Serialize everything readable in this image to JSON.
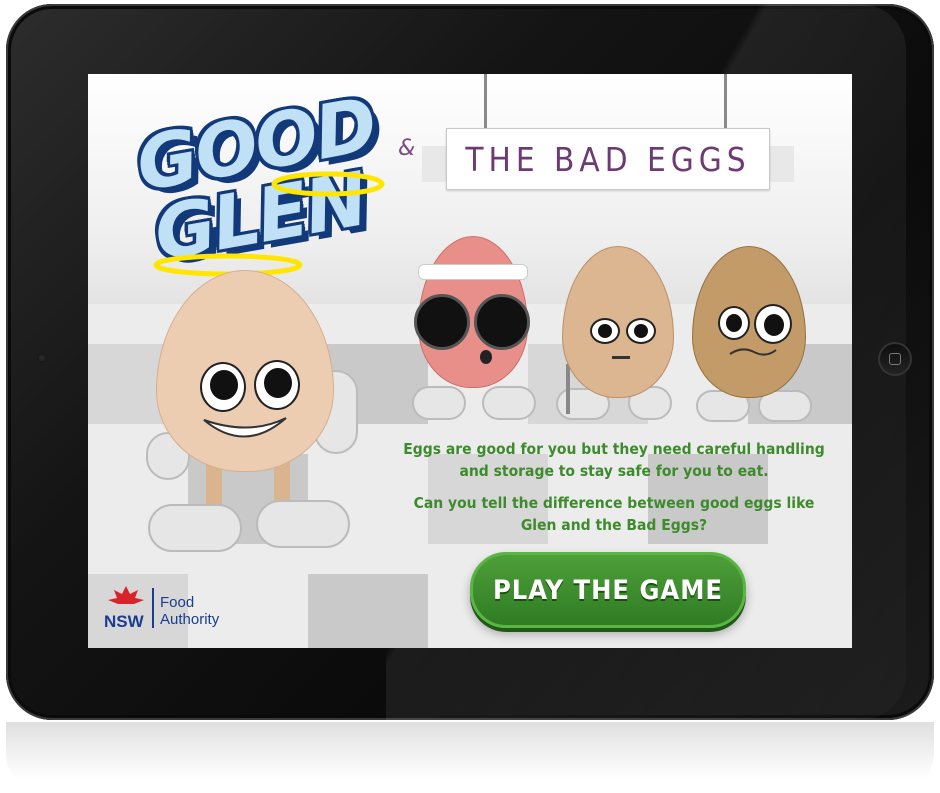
{
  "game": {
    "logo_line1": "GOOD",
    "logo_line2": "GLEN",
    "ampersand": "&",
    "subtitle": "THE BAD EGGS",
    "intro_text": "Eggs are good for you but they need careful handling and storage to stay safe for you to eat.",
    "question_text": "Can you tell the difference between good eggs like Glen and the Bad Eggs?",
    "play_button": "PLAY THE GAME"
  },
  "branding": {
    "nsw": "NSW",
    "agency_line1": "Food",
    "agency_line2": "Authority"
  },
  "colors": {
    "text_green": "#3d8b2c",
    "button_green": "#2f7c23",
    "subtitle_purple": "#6e3a73",
    "logo_blue": "#123a7a",
    "nsw_blue": "#1a3d8f",
    "waratah_red": "#d8232a"
  },
  "characters": [
    "good-glen-egg",
    "sunglasses-egg",
    "cracked-egg",
    "rotten-egg"
  ]
}
